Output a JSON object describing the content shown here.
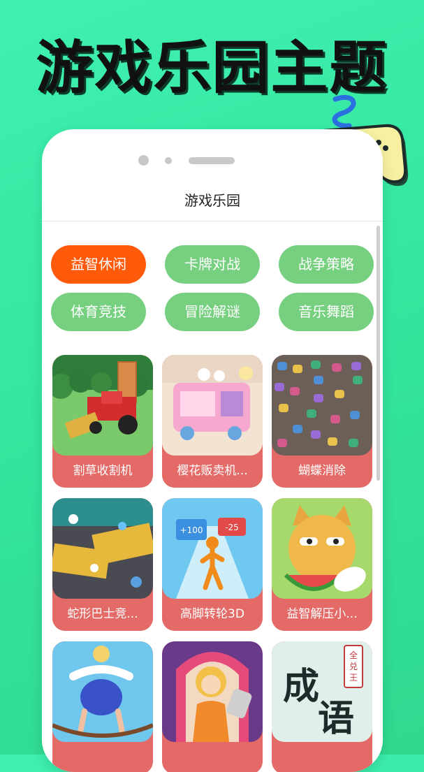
{
  "banner": {
    "headline": "游戏乐园主题"
  },
  "app": {
    "title": "游戏乐园"
  },
  "categories": [
    {
      "label": "益智休闲",
      "active": true
    },
    {
      "label": "卡牌对战",
      "active": false
    },
    {
      "label": "战争策略",
      "active": false
    },
    {
      "label": "体育竞技",
      "active": false
    },
    {
      "label": "冒险解谜",
      "active": false
    },
    {
      "label": "音乐舞蹈",
      "active": false
    }
  ],
  "games": [
    {
      "title": "割草收割机"
    },
    {
      "title": "樱花贩卖机..."
    },
    {
      "title": "蝴蝶消除"
    },
    {
      "title": "蛇形巴士竞..."
    },
    {
      "title": "高脚转轮3D",
      "thumb_texts": [
        "+100",
        "-25"
      ]
    },
    {
      "title": "益智解压小..."
    },
    {
      "title": ""
    },
    {
      "title": ""
    },
    {
      "title": "",
      "thumb_texts": [
        "成",
        "语",
        "全",
        "兑",
        "王"
      ]
    }
  ],
  "colors": {
    "active_category": "#ff5a0a",
    "category": "#77d07f",
    "card": "#e36a66"
  }
}
